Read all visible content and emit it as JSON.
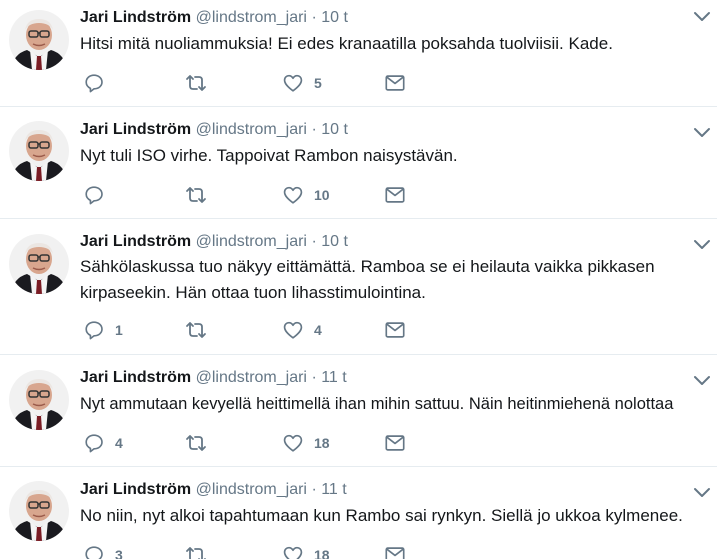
{
  "tweets": [
    {
      "name": "Jari Lindström",
      "handle": "@lindstrom_jari",
      "separator": "·",
      "time": "10 t",
      "text": "Hitsi mitä nuoliammuksia! Ei edes kranaatilla poksahda tuolviisii. Kade.",
      "replies": "",
      "retweets": "",
      "likes": "5"
    },
    {
      "name": "Jari Lindström",
      "handle": "@lindstrom_jari",
      "separator": "·",
      "time": "10 t",
      "text": "Nyt tuli ISO virhe. Tappoivat Rambon naisystävän.",
      "replies": "",
      "retweets": "",
      "likes": "10"
    },
    {
      "name": "Jari Lindström",
      "handle": "@lindstrom_jari",
      "separator": "·",
      "time": "10 t",
      "text": "Sähkölaskussa tuo näkyy eittämättä. Ramboa se ei heilauta vaikka pikkasen kirpaseekin. Hän ottaa tuon lihasstimulointina.",
      "replies": "1",
      "retweets": "",
      "likes": "4"
    },
    {
      "name": "Jari Lindström",
      "handle": "@lindstrom_jari",
      "separator": "·",
      "time": "11 t",
      "text": "Nyt ammutaan kevyellä heittimellä ihan mihin sattuu. Näin heitinmiehenä nolottaa",
      "replies": "4",
      "retweets": "",
      "likes": "18"
    },
    {
      "name": "Jari Lindström",
      "handle": "@lindstrom_jari",
      "separator": "·",
      "time": "11 t",
      "text": "No niin, nyt alkoi tapahtumaan kun Rambo sai rynkyn. Siellä jo ukkoa kylmenee.",
      "replies": "3",
      "retweets": "",
      "likes": "18"
    }
  ],
  "icons": {
    "reply": "reply-icon",
    "retweet": "retweet-icon",
    "like": "heart-icon",
    "message": "envelope-icon",
    "caret": "chevron-down-icon",
    "avatar": "profile-photo"
  },
  "colors": {
    "text": "#14171a",
    "secondary": "#657786",
    "border": "#e6ecf0"
  }
}
